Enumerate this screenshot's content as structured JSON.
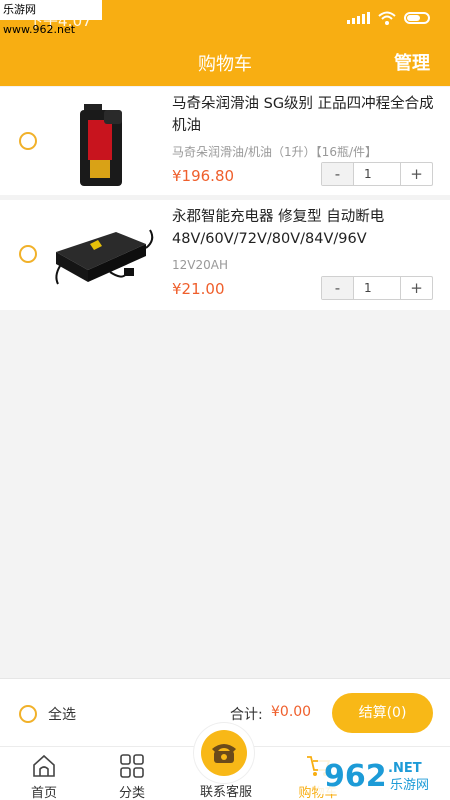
{
  "watermark": "乐游网 www.962.net",
  "status_bar": {
    "time": "下午4:07"
  },
  "header": {
    "title": "购物车",
    "manage": "管理"
  },
  "cart": {
    "items": [
      {
        "name": "马奇朵润滑油  SG级别  正品四冲程全合成机油",
        "spec": "马奇朵润滑油/机油（1升）【16瓶/件】",
        "price": "¥196.80",
        "qty": "1",
        "minus": "-",
        "plus": "+"
      },
      {
        "name": "永郡智能充电器 修复型 自动断电48V/60V/72V/80V/84V/96V",
        "spec": "12V20AH",
        "price": "¥21.00",
        "qty": "1",
        "minus": "-",
        "plus": "+"
      }
    ]
  },
  "footer": {
    "select_all": "全选",
    "total_label": "合计:",
    "total_value": "¥0.00",
    "checkout": "结算(0)"
  },
  "tabs": {
    "home": "首页",
    "category": "分类",
    "contact": "联系客服",
    "cart": "购物车"
  },
  "logo": {
    "text": "962",
    "sub": "乐游网",
    "suffix": ".NET"
  },
  "colors": {
    "brand": "#f8ae12",
    "price": "#ef5f2c",
    "radio": "#f1b12a"
  }
}
